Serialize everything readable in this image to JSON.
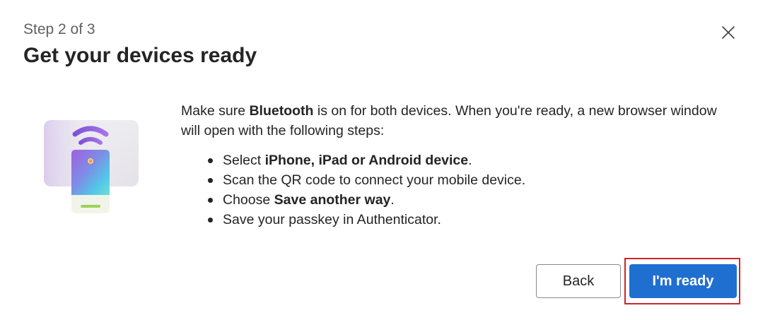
{
  "dialog": {
    "step": "Step 2 of 3",
    "title": "Get your devices ready",
    "intro": {
      "pre": "Make sure ",
      "bold": "Bluetooth",
      "post": " is on for both devices. When you're ready, a new browser window will open with the following steps:"
    },
    "steps": [
      {
        "pre": "Select ",
        "bold": "iPhone, iPad or Android device",
        "post": "."
      },
      {
        "pre": "Scan the QR code to connect your mobile device.",
        "bold": "",
        "post": ""
      },
      {
        "pre": "Choose ",
        "bold": "Save another way",
        "post": "."
      },
      {
        "pre": "Save your passkey in Authenticator.",
        "bold": "",
        "post": ""
      }
    ],
    "buttons": {
      "back_label": "Back",
      "ready_label": "I'm ready"
    },
    "close_icon": "close-icon",
    "illustration_icon": "phone-wireless-icon",
    "colors": {
      "primary": "#1f6fd1",
      "highlight": "#d1232a",
      "text": "#242424",
      "muted": "#616161"
    }
  }
}
